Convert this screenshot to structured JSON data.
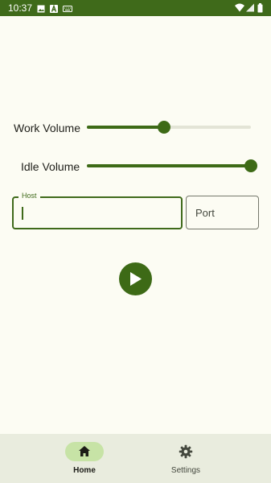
{
  "status_bar": {
    "time": "10:37",
    "left_icons": [
      "image-icon",
      "a-icon",
      "keyboard-icon"
    ],
    "right_icons": [
      "wifi-icon",
      "signal-icon",
      "battery-icon"
    ]
  },
  "controls": {
    "work_volume": {
      "label": "Work Volume",
      "value": 0.47
    },
    "idle_volume": {
      "label": "Idle Volume",
      "value": 1.0
    }
  },
  "connection": {
    "host": {
      "label": "Host",
      "value": ""
    },
    "port": {
      "placeholder": "Port",
      "value": ""
    }
  },
  "play_button": {
    "icon": "play-icon"
  },
  "bottom_nav": {
    "items": [
      {
        "label": "Home",
        "icon": "home-icon",
        "selected": true
      },
      {
        "label": "Settings",
        "icon": "gear-icon",
        "selected": false
      }
    ]
  },
  "colors": {
    "primary": "#3d6a16",
    "status_bar": "#3f6a1a",
    "background": "#fcfcf3",
    "nav_background": "#e9ecde",
    "nav_indicator": "#c7e3a6",
    "track_inactive": "#e3e4d6"
  }
}
